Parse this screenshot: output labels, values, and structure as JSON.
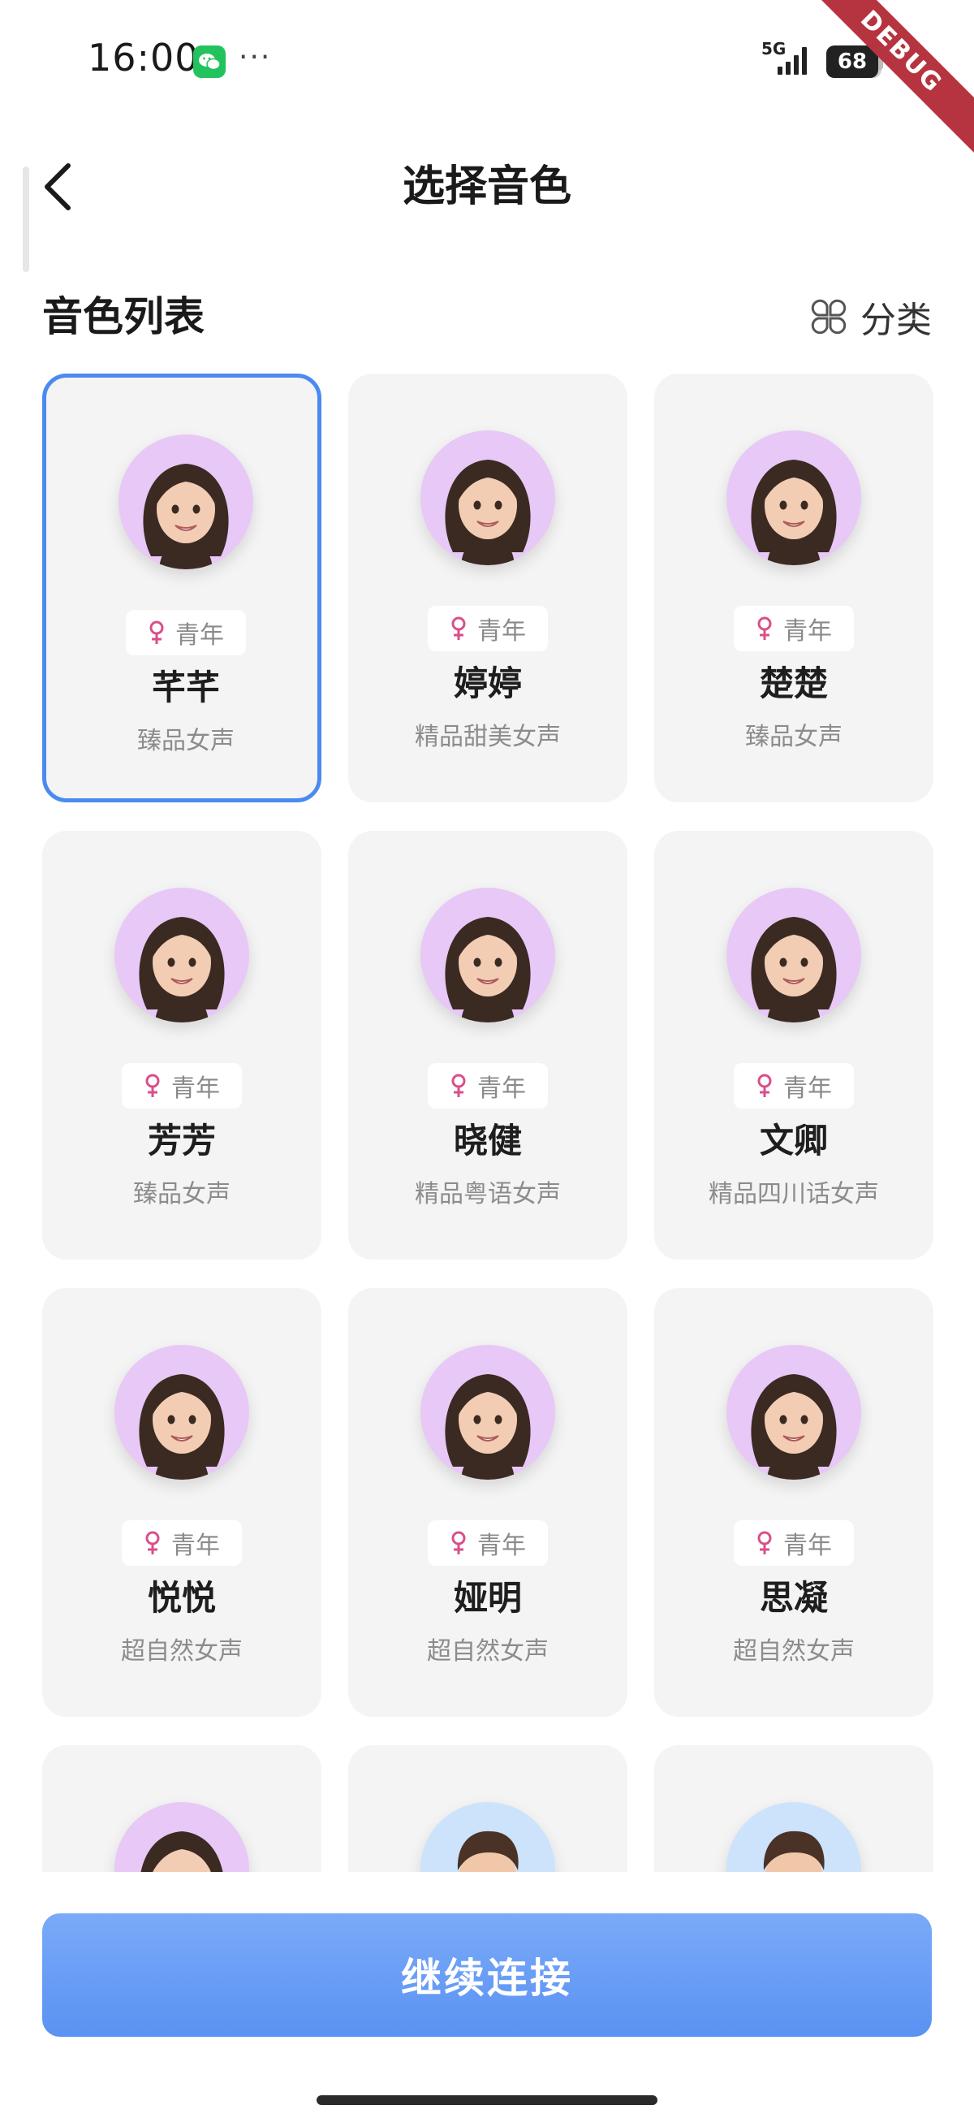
{
  "status_bar": {
    "time": "16:00",
    "dots": "···",
    "network": "5G",
    "battery": "68"
  },
  "debug_banner": "DEBUG",
  "nav": {
    "title": "选择音色"
  },
  "section": {
    "title": "音色列表",
    "category_label": "分类"
  },
  "voices": [
    {
      "tag": "青年",
      "name": "芊芊",
      "desc": "臻品女声",
      "gender": "female",
      "selected": true
    },
    {
      "tag": "青年",
      "name": "婷婷",
      "desc": "精品甜美女声",
      "gender": "female"
    },
    {
      "tag": "青年",
      "name": "楚楚",
      "desc": "臻品女声",
      "gender": "female"
    },
    {
      "tag": "青年",
      "name": "芳芳",
      "desc": "臻品女声",
      "gender": "female"
    },
    {
      "tag": "青年",
      "name": "晓健",
      "desc": "精品粤语女声",
      "gender": "female"
    },
    {
      "tag": "青年",
      "name": "文卿",
      "desc": "精品四川话女声",
      "gender": "female"
    },
    {
      "tag": "青年",
      "name": "悦悦",
      "desc": "超自然女声",
      "gender": "female"
    },
    {
      "tag": "青年",
      "name": "娅明",
      "desc": "超自然女声",
      "gender": "female"
    },
    {
      "tag": "青年",
      "name": "思凝",
      "desc": "超自然女声",
      "gender": "female"
    },
    {
      "gender": "female"
    },
    {
      "gender": "male"
    },
    {
      "gender": "male"
    }
  ],
  "continue_button": "继续连接",
  "colors": {
    "accent": "#4b8af0",
    "card_bg": "#f4f4f4",
    "female_avatar_bg": "#e8c8f6",
    "male_avatar_bg": "#cce3fb",
    "female_symbol": "#d94f8a"
  }
}
